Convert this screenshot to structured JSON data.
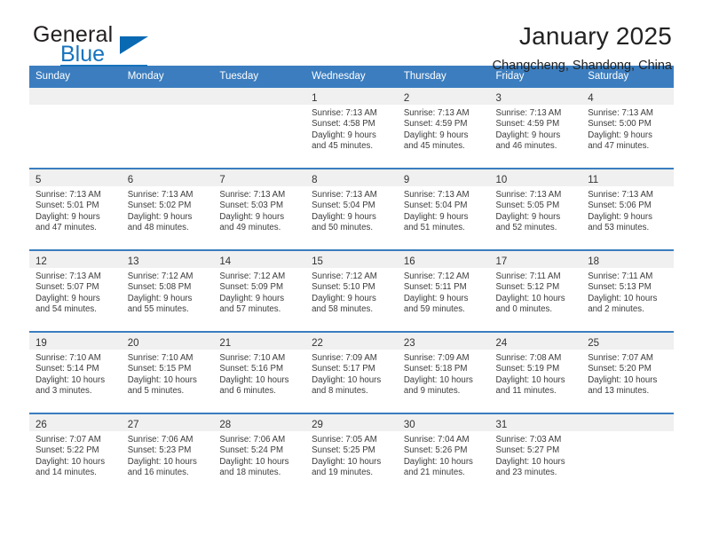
{
  "logo": {
    "word_top": "General",
    "word_bottom": "Blue",
    "accent_color": "#1673bd"
  },
  "header": {
    "title": "January 2025",
    "subtitle": "Changcheng, Shandong, China"
  },
  "theme": {
    "header_bar": "#3b7dbf",
    "daynum_band": "#f0f0f0",
    "text": "#3c3c3c"
  },
  "weekdays": [
    "Sunday",
    "Monday",
    "Tuesday",
    "Wednesday",
    "Thursday",
    "Friday",
    "Saturday"
  ],
  "labels": {
    "sunrise_prefix": "Sunrise:",
    "sunset_prefix": "Sunset:",
    "daylight_prefix": "Daylight:"
  },
  "weeks": [
    [
      {
        "day": "",
        "empty": true
      },
      {
        "day": "",
        "empty": true
      },
      {
        "day": "",
        "empty": true
      },
      {
        "day": "1",
        "l1": "Sunrise: 7:13 AM",
        "l2": "Sunset: 4:58 PM",
        "l3": "Daylight: 9 hours",
        "l4": "and 45 minutes."
      },
      {
        "day": "2",
        "l1": "Sunrise: 7:13 AM",
        "l2": "Sunset: 4:59 PM",
        "l3": "Daylight: 9 hours",
        "l4": "and 45 minutes."
      },
      {
        "day": "3",
        "l1": "Sunrise: 7:13 AM",
        "l2": "Sunset: 4:59 PM",
        "l3": "Daylight: 9 hours",
        "l4": "and 46 minutes."
      },
      {
        "day": "4",
        "l1": "Sunrise: 7:13 AM",
        "l2": "Sunset: 5:00 PM",
        "l3": "Daylight: 9 hours",
        "l4": "and 47 minutes."
      }
    ],
    [
      {
        "day": "5",
        "l1": "Sunrise: 7:13 AM",
        "l2": "Sunset: 5:01 PM",
        "l3": "Daylight: 9 hours",
        "l4": "and 47 minutes."
      },
      {
        "day": "6",
        "l1": "Sunrise: 7:13 AM",
        "l2": "Sunset: 5:02 PM",
        "l3": "Daylight: 9 hours",
        "l4": "and 48 minutes."
      },
      {
        "day": "7",
        "l1": "Sunrise: 7:13 AM",
        "l2": "Sunset: 5:03 PM",
        "l3": "Daylight: 9 hours",
        "l4": "and 49 minutes."
      },
      {
        "day": "8",
        "l1": "Sunrise: 7:13 AM",
        "l2": "Sunset: 5:04 PM",
        "l3": "Daylight: 9 hours",
        "l4": "and 50 minutes."
      },
      {
        "day": "9",
        "l1": "Sunrise: 7:13 AM",
        "l2": "Sunset: 5:04 PM",
        "l3": "Daylight: 9 hours",
        "l4": "and 51 minutes."
      },
      {
        "day": "10",
        "l1": "Sunrise: 7:13 AM",
        "l2": "Sunset: 5:05 PM",
        "l3": "Daylight: 9 hours",
        "l4": "and 52 minutes."
      },
      {
        "day": "11",
        "l1": "Sunrise: 7:13 AM",
        "l2": "Sunset: 5:06 PM",
        "l3": "Daylight: 9 hours",
        "l4": "and 53 minutes."
      }
    ],
    [
      {
        "day": "12",
        "l1": "Sunrise: 7:13 AM",
        "l2": "Sunset: 5:07 PM",
        "l3": "Daylight: 9 hours",
        "l4": "and 54 minutes."
      },
      {
        "day": "13",
        "l1": "Sunrise: 7:12 AM",
        "l2": "Sunset: 5:08 PM",
        "l3": "Daylight: 9 hours",
        "l4": "and 55 minutes."
      },
      {
        "day": "14",
        "l1": "Sunrise: 7:12 AM",
        "l2": "Sunset: 5:09 PM",
        "l3": "Daylight: 9 hours",
        "l4": "and 57 minutes."
      },
      {
        "day": "15",
        "l1": "Sunrise: 7:12 AM",
        "l2": "Sunset: 5:10 PM",
        "l3": "Daylight: 9 hours",
        "l4": "and 58 minutes."
      },
      {
        "day": "16",
        "l1": "Sunrise: 7:12 AM",
        "l2": "Sunset: 5:11 PM",
        "l3": "Daylight: 9 hours",
        "l4": "and 59 minutes."
      },
      {
        "day": "17",
        "l1": "Sunrise: 7:11 AM",
        "l2": "Sunset: 5:12 PM",
        "l3": "Daylight: 10 hours",
        "l4": "and 0 minutes."
      },
      {
        "day": "18",
        "l1": "Sunrise: 7:11 AM",
        "l2": "Sunset: 5:13 PM",
        "l3": "Daylight: 10 hours",
        "l4": "and 2 minutes."
      }
    ],
    [
      {
        "day": "19",
        "l1": "Sunrise: 7:10 AM",
        "l2": "Sunset: 5:14 PM",
        "l3": "Daylight: 10 hours",
        "l4": "and 3 minutes."
      },
      {
        "day": "20",
        "l1": "Sunrise: 7:10 AM",
        "l2": "Sunset: 5:15 PM",
        "l3": "Daylight: 10 hours",
        "l4": "and 5 minutes."
      },
      {
        "day": "21",
        "l1": "Sunrise: 7:10 AM",
        "l2": "Sunset: 5:16 PM",
        "l3": "Daylight: 10 hours",
        "l4": "and 6 minutes."
      },
      {
        "day": "22",
        "l1": "Sunrise: 7:09 AM",
        "l2": "Sunset: 5:17 PM",
        "l3": "Daylight: 10 hours",
        "l4": "and 8 minutes."
      },
      {
        "day": "23",
        "l1": "Sunrise: 7:09 AM",
        "l2": "Sunset: 5:18 PM",
        "l3": "Daylight: 10 hours",
        "l4": "and 9 minutes."
      },
      {
        "day": "24",
        "l1": "Sunrise: 7:08 AM",
        "l2": "Sunset: 5:19 PM",
        "l3": "Daylight: 10 hours",
        "l4": "and 11 minutes."
      },
      {
        "day": "25",
        "l1": "Sunrise: 7:07 AM",
        "l2": "Sunset: 5:20 PM",
        "l3": "Daylight: 10 hours",
        "l4": "and 13 minutes."
      }
    ],
    [
      {
        "day": "26",
        "l1": "Sunrise: 7:07 AM",
        "l2": "Sunset: 5:22 PM",
        "l3": "Daylight: 10 hours",
        "l4": "and 14 minutes."
      },
      {
        "day": "27",
        "l1": "Sunrise: 7:06 AM",
        "l2": "Sunset: 5:23 PM",
        "l3": "Daylight: 10 hours",
        "l4": "and 16 minutes."
      },
      {
        "day": "28",
        "l1": "Sunrise: 7:06 AM",
        "l2": "Sunset: 5:24 PM",
        "l3": "Daylight: 10 hours",
        "l4": "and 18 minutes."
      },
      {
        "day": "29",
        "l1": "Sunrise: 7:05 AM",
        "l2": "Sunset: 5:25 PM",
        "l3": "Daylight: 10 hours",
        "l4": "and 19 minutes."
      },
      {
        "day": "30",
        "l1": "Sunrise: 7:04 AM",
        "l2": "Sunset: 5:26 PM",
        "l3": "Daylight: 10 hours",
        "l4": "and 21 minutes."
      },
      {
        "day": "31",
        "l1": "Sunrise: 7:03 AM",
        "l2": "Sunset: 5:27 PM",
        "l3": "Daylight: 10 hours",
        "l4": "and 23 minutes."
      },
      {
        "day": "",
        "empty": true
      }
    ]
  ]
}
